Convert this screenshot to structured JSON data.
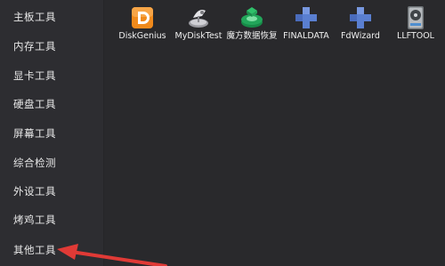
{
  "sidebar": {
    "items": [
      {
        "label": "主板工具"
      },
      {
        "label": "内存工具"
      },
      {
        "label": "显卡工具"
      },
      {
        "label": "硬盘工具"
      },
      {
        "label": "屏幕工具"
      },
      {
        "label": "综合检测"
      },
      {
        "label": "外设工具"
      },
      {
        "label": "烤鸡工具"
      },
      {
        "label": "其他工具"
      }
    ]
  },
  "tools": [
    {
      "label": "DiskGenius",
      "icon": "diskgenius-icon"
    },
    {
      "label": "MyDiskTest",
      "icon": "disk-test-satellite-icon"
    },
    {
      "label": "魔方数据恢复",
      "icon": "data-recovery-icon"
    },
    {
      "label": "FINALDATA",
      "icon": "blue-cross-icon"
    },
    {
      "label": "FdWizard",
      "icon": "blue-cross-icon"
    },
    {
      "label": "LLFTOOL",
      "icon": "hard-drive-icon"
    }
  ],
  "colors": {
    "background": "#2b2b2e",
    "sidebar": "#2d2d31",
    "text": "#e8e8e8",
    "annotation_arrow": "#e03a36",
    "diskgenius_orange": "#f08a1c",
    "recovery_green": "#22a65a",
    "cross_blue": "#5a7fd0"
  }
}
